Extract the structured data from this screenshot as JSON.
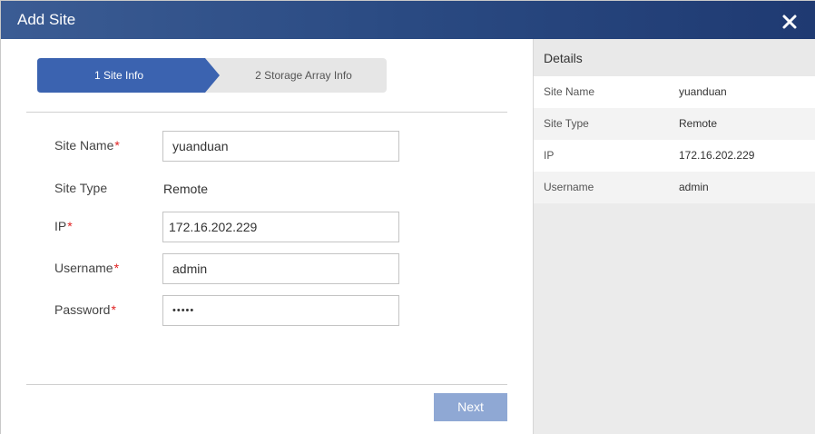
{
  "dialog": {
    "title": "Add Site",
    "close_icon": "close-icon"
  },
  "wizard": {
    "steps": [
      {
        "label": "1 Site Info",
        "active": true
      },
      {
        "label": "2 Storage Array Info",
        "active": false
      }
    ]
  },
  "form": {
    "site_name": {
      "label": "Site Name",
      "required": "*",
      "value": "yuanduan"
    },
    "site_type": {
      "label": "Site Type",
      "value": "Remote"
    },
    "ip": {
      "label": "IP",
      "required": "*",
      "value": "172.16.202.229"
    },
    "username": {
      "label": "Username",
      "required": "*",
      "value": "admin"
    },
    "password": {
      "label": "Password",
      "required": "*",
      "value": "•••••"
    }
  },
  "actions": {
    "next_label": "Next"
  },
  "details": {
    "title": "Details",
    "rows": [
      {
        "key": "Site Name",
        "value": "yuanduan"
      },
      {
        "key": "Site Type",
        "value": "Remote"
      },
      {
        "key": "IP",
        "value": "172.16.202.229"
      },
      {
        "key": "Username",
        "value": "admin"
      }
    ]
  },
  "colors": {
    "titlebar": "#2a4a82",
    "active_step": "#3b63b0",
    "next_button": "#8fa8d4",
    "required": "#e02020"
  }
}
